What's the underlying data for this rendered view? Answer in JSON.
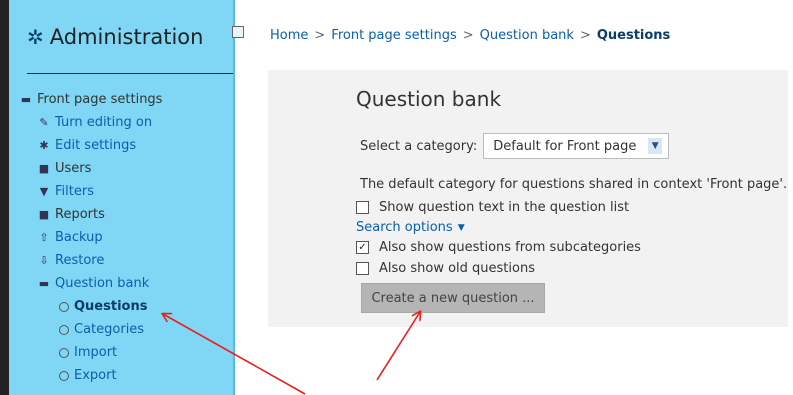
{
  "sidebar": {
    "title": "Administration",
    "icon": "gears-icon",
    "items": [
      {
        "label": "Front page settings",
        "icon": "folder-open-icon"
      },
      {
        "label": "Turn editing on",
        "icon": "pencil-icon"
      },
      {
        "label": "Edit settings",
        "icon": "cog-icon"
      },
      {
        "label": "Users",
        "icon": "folder-icon"
      },
      {
        "label": "Filters",
        "icon": "filter-icon"
      },
      {
        "label": "Reports",
        "icon": "folder-icon"
      },
      {
        "label": "Backup",
        "icon": "upload-icon"
      },
      {
        "label": "Restore",
        "icon": "download-icon"
      },
      {
        "label": "Question bank",
        "icon": "folder-open-icon"
      },
      {
        "label": "Questions"
      },
      {
        "label": "Categories"
      },
      {
        "label": "Import"
      },
      {
        "label": "Export"
      }
    ]
  },
  "breadcrumb": {
    "items": [
      "Home",
      "Front page settings",
      "Question bank",
      "Questions"
    ],
    "separator": ">"
  },
  "main": {
    "title": "Question bank",
    "category_label": "Select a category:",
    "category_value": "Default for Front page",
    "description": "The default category for questions shared in context 'Front page'.",
    "show_text_label": "Show question text in the question list",
    "show_text_checked": false,
    "search_options_label": "Search options",
    "subcategories_label": "Also show questions from subcategories",
    "subcategories_checked": true,
    "old_questions_label": "Also show old questions",
    "old_questions_checked": false,
    "create_button": "Create a new question ..."
  },
  "colors": {
    "sidebar_bg": "#7fd6f5",
    "link": "#0b5fa8",
    "panel_bg": "#f2f2f2",
    "annotation_arrow": "#e8211b"
  }
}
